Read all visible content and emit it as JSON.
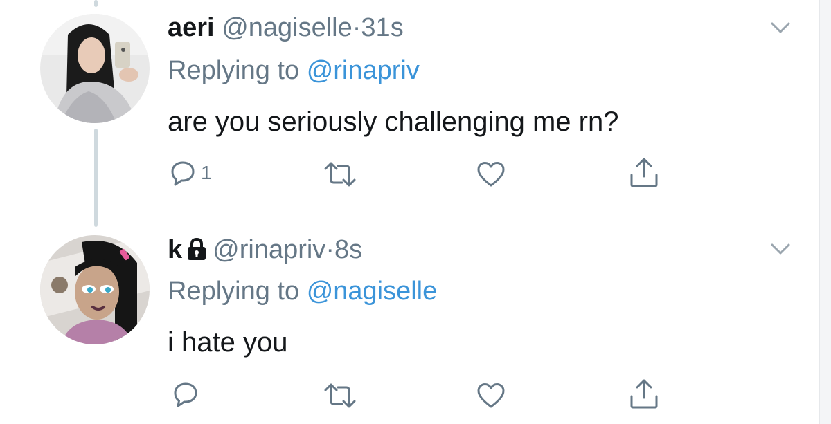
{
  "colors": {
    "text": "#14171a",
    "secondary": "#657786",
    "link": "#3b94d9",
    "thread_line": "#cfd9de"
  },
  "tweets": [
    {
      "display_name": "aeri",
      "handle": "@nagiselle",
      "separator": "·",
      "time": "31s",
      "replying_prefix": "Replying to",
      "replying_to": "@rinapriv",
      "text": "are you seriously challenging me rn?",
      "reply_count": "1",
      "locked": false,
      "icons": [
        "reply-icon",
        "retweet-icon",
        "like-icon",
        "share-icon",
        "chevron-down-icon"
      ]
    },
    {
      "display_name": "k",
      "handle": "@rinapriv",
      "separator": "·",
      "time": "8s",
      "replying_prefix": "Replying to",
      "replying_to": "@nagiselle",
      "text": "i hate you",
      "reply_count": "",
      "locked": true,
      "icons": [
        "reply-icon",
        "retweet-icon",
        "like-icon",
        "share-icon",
        "chevron-down-icon",
        "lock-icon"
      ]
    }
  ]
}
